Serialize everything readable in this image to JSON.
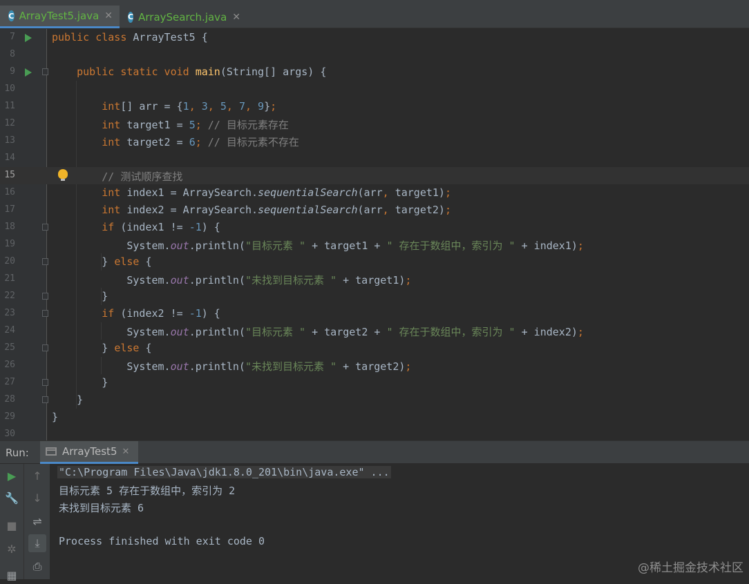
{
  "tabs": [
    {
      "label": "ArrayTest5.java",
      "icon": "java-class-icon",
      "active": true
    },
    {
      "label": "ArraySearch.java",
      "icon": "java-class-icon",
      "active": false
    }
  ],
  "editor": {
    "current_line": 15,
    "lines": [
      {
        "n": "7"
      },
      {
        "n": "8"
      },
      {
        "n": "9"
      },
      {
        "n": "10"
      },
      {
        "n": "11"
      },
      {
        "n": "12"
      },
      {
        "n": "13"
      },
      {
        "n": "14"
      },
      {
        "n": "15"
      },
      {
        "n": "16"
      },
      {
        "n": "17"
      },
      {
        "n": "18"
      },
      {
        "n": "19"
      },
      {
        "n": "20"
      },
      {
        "n": "21"
      },
      {
        "n": "22"
      },
      {
        "n": "23"
      },
      {
        "n": "24"
      },
      {
        "n": "25"
      },
      {
        "n": "26"
      },
      {
        "n": "27"
      },
      {
        "n": "28"
      },
      {
        "n": "29"
      },
      {
        "n": "30"
      }
    ],
    "code": {
      "l7_kw": "public class ",
      "l7_name": "ArrayTest5 {",
      "l9_kw": "public static void ",
      "l9_fn": "main",
      "l9_rest": "(String[] args) {",
      "l11_type": "int",
      "l11_a": "[] arr = {",
      "l11_n1": "1",
      "l11_n2": "3",
      "l11_n3": "5",
      "l11_n4": "7",
      "l11_n5": "9",
      "l11_end": "}",
      "l12_type": "int",
      "l12_a": " target1 = ",
      "l12_n": "5",
      "l12_cm": " // 目标元素存在",
      "l13_type": "int",
      "l13_a": " target2 = ",
      "l13_n": "6",
      "l13_cm": " // 目标元素不存在",
      "l15_cm": "// 测试顺序查找",
      "l16_type": "int",
      "l16_a": " index1 = ArraySearch.",
      "l16_m": "sequentialSearch",
      "l16_b": "(arr",
      "l16_c": " target1)",
      "l17_type": "int",
      "l17_a": " index2 = ArraySearch.",
      "l17_m": "sequentialSearch",
      "l17_b": "(arr",
      "l17_c": " target2)",
      "l18_kw": "if",
      "l18_a": " (index1 != ",
      "l18_n": "-1",
      "l18_b": ") {",
      "l19_a": "System.",
      "l19_f": "out",
      "l19_b": ".println(",
      "l19_s1": "\"目标元素 \"",
      "l19_c": " + target1 + ",
      "l19_s2": "\" 存在于数组中，索引为 \"",
      "l19_d": " + index1)",
      "l20_a": "} ",
      "l20_kw": "else",
      "l20_b": " {",
      "l21_a": "System.",
      "l21_f": "out",
      "l21_b": ".println(",
      "l21_s": "\"未找到目标元素 \"",
      "l21_c": " + target1)",
      "l22_a": "}",
      "l23_kw": "if",
      "l23_a": " (index2 != ",
      "l23_n": "-1",
      "l23_b": ") {",
      "l24_a": "System.",
      "l24_f": "out",
      "l24_b": ".println(",
      "l24_s1": "\"目标元素 \"",
      "l24_c": " + target2 + ",
      "l24_s2": "\" 存在于数组中，索引为 \"",
      "l24_d": " + index2)",
      "l25_a": "} ",
      "l25_kw": "else",
      "l25_b": " {",
      "l26_a": "System.",
      "l26_f": "out",
      "l26_b": ".println(",
      "l26_s": "\"未找到目标元素 \"",
      "l26_c": " + target2)",
      "l27_a": "}",
      "l28_a": "}",
      "l29_a": "}"
    }
  },
  "run_panel": {
    "label": "Run:",
    "tab_label": "ArrayTest5",
    "tools_left": [
      "run-icon",
      "wrench-icon",
      "stop-icon",
      "debug-icon",
      "layout-icon"
    ],
    "tools_right": [
      "up-arrow-icon",
      "down-arrow-icon",
      "soft-wrap-icon",
      "scroll-to-end-icon",
      "print-icon"
    ],
    "console_lines": [
      "\"C:\\Program Files\\Java\\jdk1.8.0_201\\bin\\java.exe\" ...",
      "目标元素 5 存在于数组中，索引为 2",
      "未找到目标元素 6",
      "",
      "Process finished with exit code 0"
    ]
  },
  "watermark": "@稀土掘金技术社区",
  "colors": {
    "keyword": "#cc7832",
    "number": "#6897bb",
    "string": "#6a8759",
    "comment": "#808080",
    "method": "#ffc66d",
    "field": "#9876aa",
    "tab_label": "#62b543"
  }
}
